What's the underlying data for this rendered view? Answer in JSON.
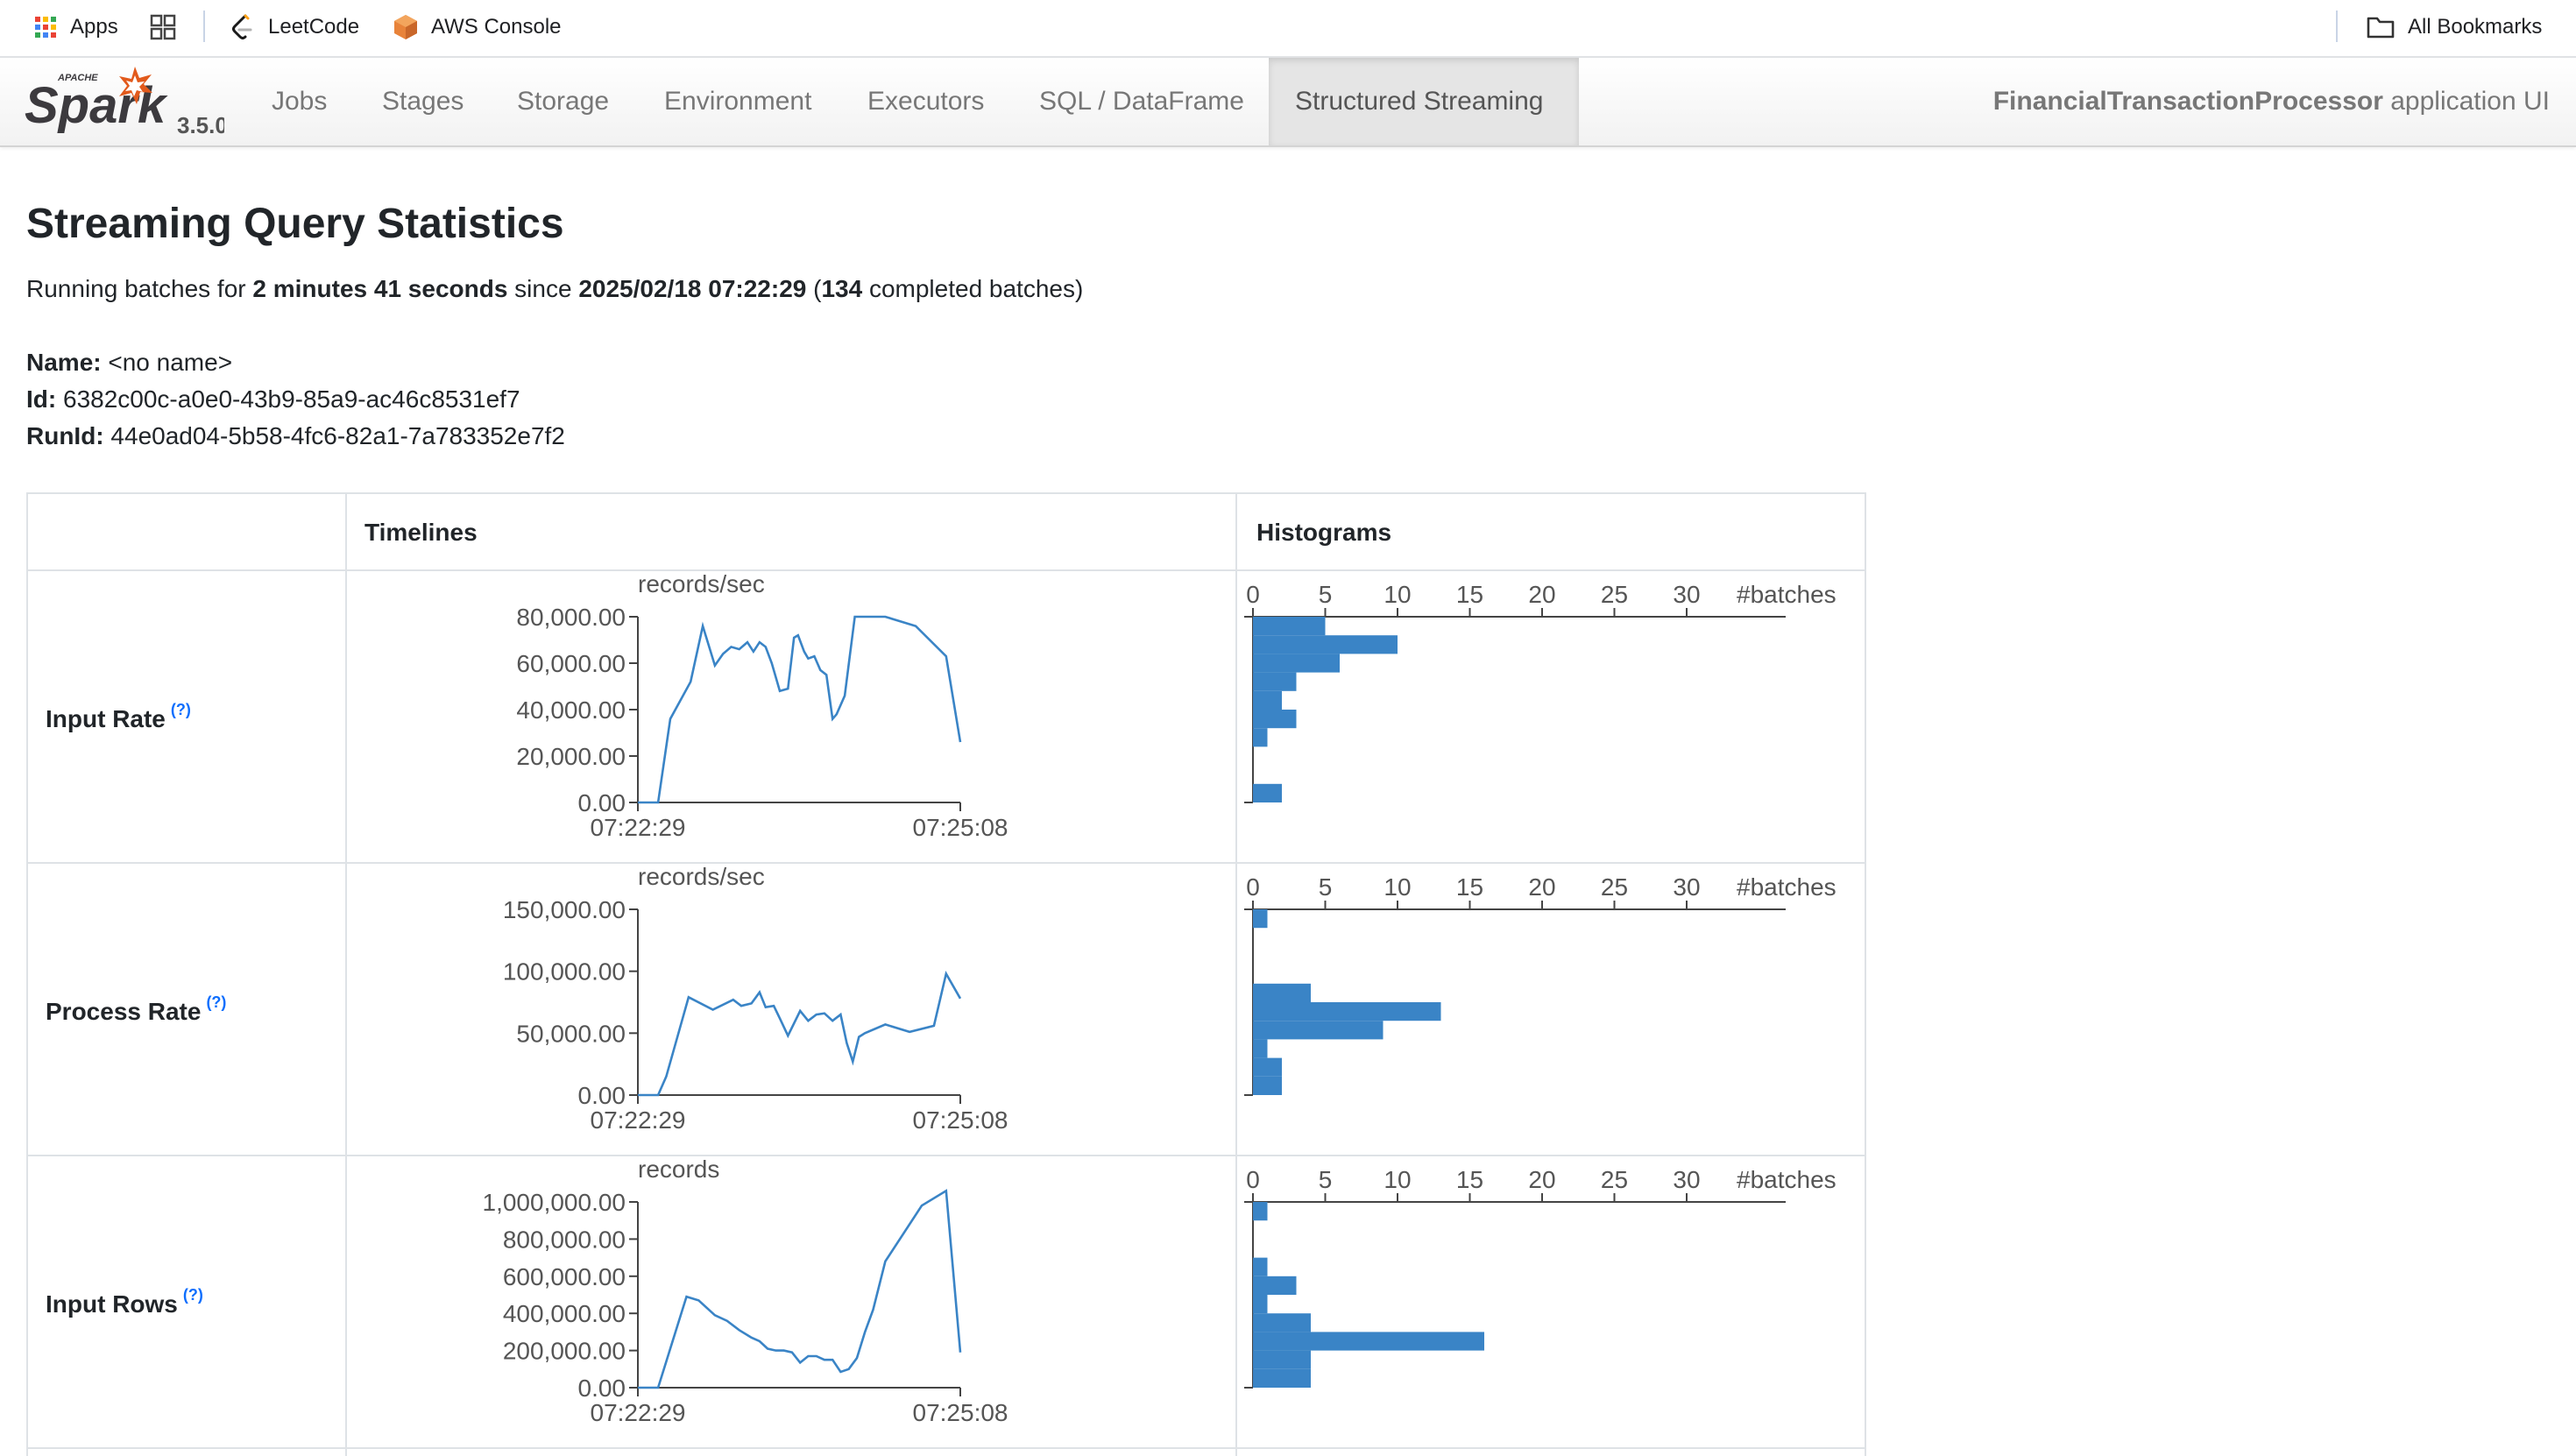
{
  "bookmarks_bar": {
    "items": [
      {
        "label": "Apps",
        "icon": "apps-grid-icon"
      },
      {
        "label": "",
        "icon": "tab-groups-icon"
      },
      {
        "label": "LeetCode",
        "icon": "leetcode-icon"
      },
      {
        "label": "AWS Console",
        "icon": "aws-cube-icon"
      }
    ],
    "all_bookmarks": {
      "label": "All Bookmarks",
      "icon": "folder-icon"
    }
  },
  "navbar": {
    "logo_text": "Spark",
    "logo_small": "APACHE",
    "version": "3.5.0",
    "tabs": [
      {
        "label": "Jobs",
        "active": false
      },
      {
        "label": "Stages",
        "active": false
      },
      {
        "label": "Storage",
        "active": false
      },
      {
        "label": "Environment",
        "active": false
      },
      {
        "label": "Executors",
        "active": false
      },
      {
        "label": "SQL / DataFrame",
        "active": false
      },
      {
        "label": "Structured Streaming",
        "active": true
      }
    ],
    "app_name": "FinancialTransactionProcessor",
    "app_suffix": " application UI"
  },
  "page": {
    "title": "Streaming Query Statistics",
    "summary": {
      "prefix": "Running batches for ",
      "duration": "2 minutes 41 seconds",
      "since": " since ",
      "start": "2025/02/18 07:22:29",
      "open": " (",
      "count": "134",
      "suffix": " completed batches)"
    },
    "meta": {
      "name_label": "Name:",
      "name_value": " <no name>",
      "id_label": "Id:",
      "id_value": " 6382c00c-a0e0-43b9-85a9-ac46c8531ef7",
      "runid_label": "RunId:",
      "runid_value": " 44e0ad04-5b58-4fc6-82a1-7a783352e7f2"
    }
  },
  "table": {
    "headers": [
      "",
      "Timelines",
      "Histograms"
    ],
    "help_mark": "(?)",
    "rows": [
      {
        "label": "Input Rate",
        "unit": "records/sec"
      },
      {
        "label": "Process Rate",
        "unit": "records/sec"
      },
      {
        "label": "Input Rows",
        "unit": "records"
      }
    ]
  },
  "chart_data": [
    {
      "type": "line",
      "name": "Input Rate timeline",
      "ylabel": "records/sec",
      "x_ticks": [
        "07:22:29",
        "07:25:08"
      ],
      "y_ticks": [
        "0.00",
        "20,000.00",
        "40,000.00",
        "60,000.00",
        "80,000.00"
      ],
      "ylim": [
        0,
        80000
      ],
      "x_range_seconds": [
        0,
        159
      ],
      "series": [
        {
          "x": [
            0,
            10,
            16,
            26,
            32,
            38,
            42,
            46,
            50,
            54,
            57,
            60,
            63,
            66,
            70,
            74,
            77,
            79,
            82,
            84,
            87,
            90,
            93,
            96,
            98,
            102,
            107,
            122,
            137,
            152,
            159
          ],
          "values": [
            0,
            0,
            36000,
            52000,
            76000,
            59000,
            64000,
            67000,
            66000,
            69000,
            65000,
            69000,
            67000,
            60000,
            48000,
            49000,
            71000,
            72000,
            65000,
            62000,
            63000,
            57000,
            55000,
            36000,
            38000,
            46000,
            80000,
            80000,
            76000,
            63000,
            26000
          ]
        }
      ]
    },
    {
      "type": "bar",
      "name": "Input Rate histogram",
      "orientation": "horizontal",
      "xlabel": "#batches",
      "x_ticks": [
        0,
        5,
        10,
        15,
        20,
        25,
        30
      ],
      "bins_y_range": [
        0,
        80000
      ],
      "counts": [
        5,
        10,
        6,
        3,
        2,
        3,
        1,
        0,
        0,
        2
      ]
    },
    {
      "type": "line",
      "name": "Process Rate timeline",
      "ylabel": "records/sec",
      "x_ticks": [
        "07:22:29",
        "07:25:08"
      ],
      "y_ticks": [
        "0.00",
        "50,000.00",
        "100,000.00",
        "150,000.00"
      ],
      "ylim": [
        0,
        150000
      ],
      "x_range_seconds": [
        0,
        159
      ],
      "series": [
        {
          "x": [
            0,
            10,
            14,
            25,
            37,
            47,
            51,
            56,
            60,
            63,
            67,
            70,
            74,
            80,
            84,
            88,
            92,
            96,
            100,
            103,
            106,
            109,
            112,
            122,
            134,
            146,
            152,
            159
          ],
          "values": [
            0,
            0,
            15000,
            79000,
            69000,
            77000,
            72000,
            74000,
            83000,
            71000,
            72000,
            62000,
            48000,
            68000,
            60000,
            65000,
            66000,
            60000,
            65000,
            42000,
            27000,
            47000,
            50000,
            57000,
            51000,
            56000,
            98000,
            78000
          ]
        }
      ]
    },
    {
      "type": "bar",
      "name": "Process Rate histogram",
      "orientation": "horizontal",
      "xlabel": "#batches",
      "x_ticks": [
        0,
        5,
        10,
        15,
        20,
        25,
        30
      ],
      "bins_y_range": [
        0,
        150000
      ],
      "counts": [
        1,
        0,
        0,
        0,
        4,
        13,
        9,
        1,
        2,
        2
      ]
    },
    {
      "type": "line",
      "name": "Input Rows timeline",
      "ylabel": "records",
      "x_ticks": [
        "07:22:29",
        "07:25:08"
      ],
      "y_ticks": [
        "0.00",
        "200,000.00",
        "400,000.00",
        "600,000.00",
        "800,000.00",
        "1,000,000.00"
      ],
      "ylim": [
        0,
        1000000
      ],
      "x_range_seconds": [
        0,
        159
      ],
      "series": [
        {
          "x": [
            0,
            10,
            24,
            30,
            38,
            44,
            50,
            56,
            60,
            64,
            68,
            72,
            76,
            80,
            84,
            88,
            92,
            96,
            100,
            104,
            108,
            112,
            116,
            122,
            140,
            152,
            159
          ],
          "values": [
            0,
            0,
            490000,
            470000,
            390000,
            360000,
            310000,
            270000,
            250000,
            210000,
            200000,
            200000,
            190000,
            135000,
            170000,
            170000,
            150000,
            150000,
            85000,
            100000,
            160000,
            300000,
            420000,
            680000,
            980000,
            1060000,
            190000
          ]
        }
      ]
    },
    {
      "type": "bar",
      "name": "Input Rows histogram",
      "orientation": "horizontal",
      "xlabel": "#batches",
      "x_ticks": [
        0,
        5,
        10,
        15,
        20,
        25,
        30
      ],
      "bins_y_range": [
        0,
        1000000
      ],
      "counts": [
        1,
        0,
        0,
        1,
        3,
        1,
        4,
        16,
        4,
        4
      ]
    }
  ]
}
